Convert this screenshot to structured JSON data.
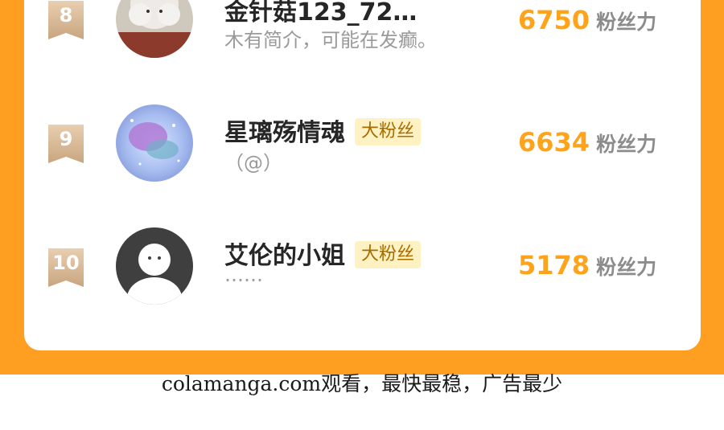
{
  "ranking": [
    {
      "rank": "8",
      "name": "金针菇123_72…",
      "badge": "",
      "bio": "木有简介，可能在发癫。",
      "score": "6750",
      "score_unit": "粉丝力"
    },
    {
      "rank": "9",
      "name": "星璃殇情魂",
      "badge": "大粉丝",
      "bio": "（@）",
      "score": "6634",
      "score_unit": "粉丝力"
    },
    {
      "rank": "10",
      "name": "艾伦的小姐",
      "badge": "大粉丝",
      "bio": "……",
      "score": "5178",
      "score_unit": "粉丝力"
    }
  ],
  "footer": {
    "text": "colamanga.com观看，最快最稳，广告最少"
  },
  "colors": {
    "frame": "#ff9f22",
    "score": "#ffa31a",
    "badge_bg": "#fff2c2",
    "rank_badge": "#d8b894"
  },
  "icons": [
    "rank-ribbon-icon",
    "avatar-image",
    "default-avatar-icon"
  ]
}
